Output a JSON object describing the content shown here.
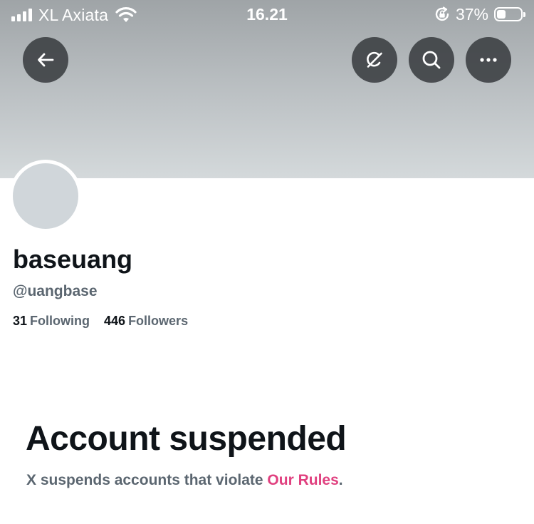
{
  "status_bar": {
    "carrier": "XL Axiata",
    "time": "16.21",
    "battery_percent": "37%",
    "battery_level": 0.37,
    "signal_bars": 4
  },
  "header": {
    "back_icon": "arrow-left-icon",
    "grok_icon": "grok-icon",
    "search_icon": "search-icon",
    "more_icon": "more-horizontal-icon"
  },
  "profile": {
    "display_name": "baseuang",
    "handle": "@uangbase",
    "following_count": "31",
    "following_label": "Following",
    "followers_count": "446",
    "followers_label": "Followers"
  },
  "suspension": {
    "title": "Account suspended",
    "description_prefix": "X suspends accounts that violate ",
    "rules_link": "Our Rules",
    "description_suffix": "."
  },
  "colors": {
    "link": "#e0407f",
    "avatar_placeholder": "#d0d6da",
    "text_primary": "#0f1419",
    "text_secondary": "#5b6670"
  }
}
